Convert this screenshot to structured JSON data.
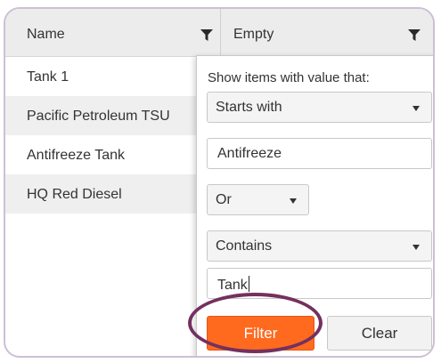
{
  "columns": {
    "name_label": "Name",
    "empty_label": "Empty"
  },
  "rows": [
    {
      "name": "Tank 1"
    },
    {
      "name": "Pacific Petroleum TSU"
    },
    {
      "name": "Antifreeze Tank"
    },
    {
      "name": "HQ Red Diesel"
    }
  ],
  "filter_popup": {
    "instruction": "Show items with value that:",
    "operator1": "Starts with",
    "value1": "Antifreeze",
    "logic": "Or",
    "operator2": "Contains",
    "value2": "Tank",
    "filter_button": "Filter",
    "clear_button": "Clear"
  },
  "colors": {
    "filter_button": "#ff6a1f",
    "highlight_ring": "#74305f",
    "frame_border": "#cdbfd6"
  },
  "icons": [
    "filter-funnel-icon",
    "dropdown-arrow-icon"
  ]
}
